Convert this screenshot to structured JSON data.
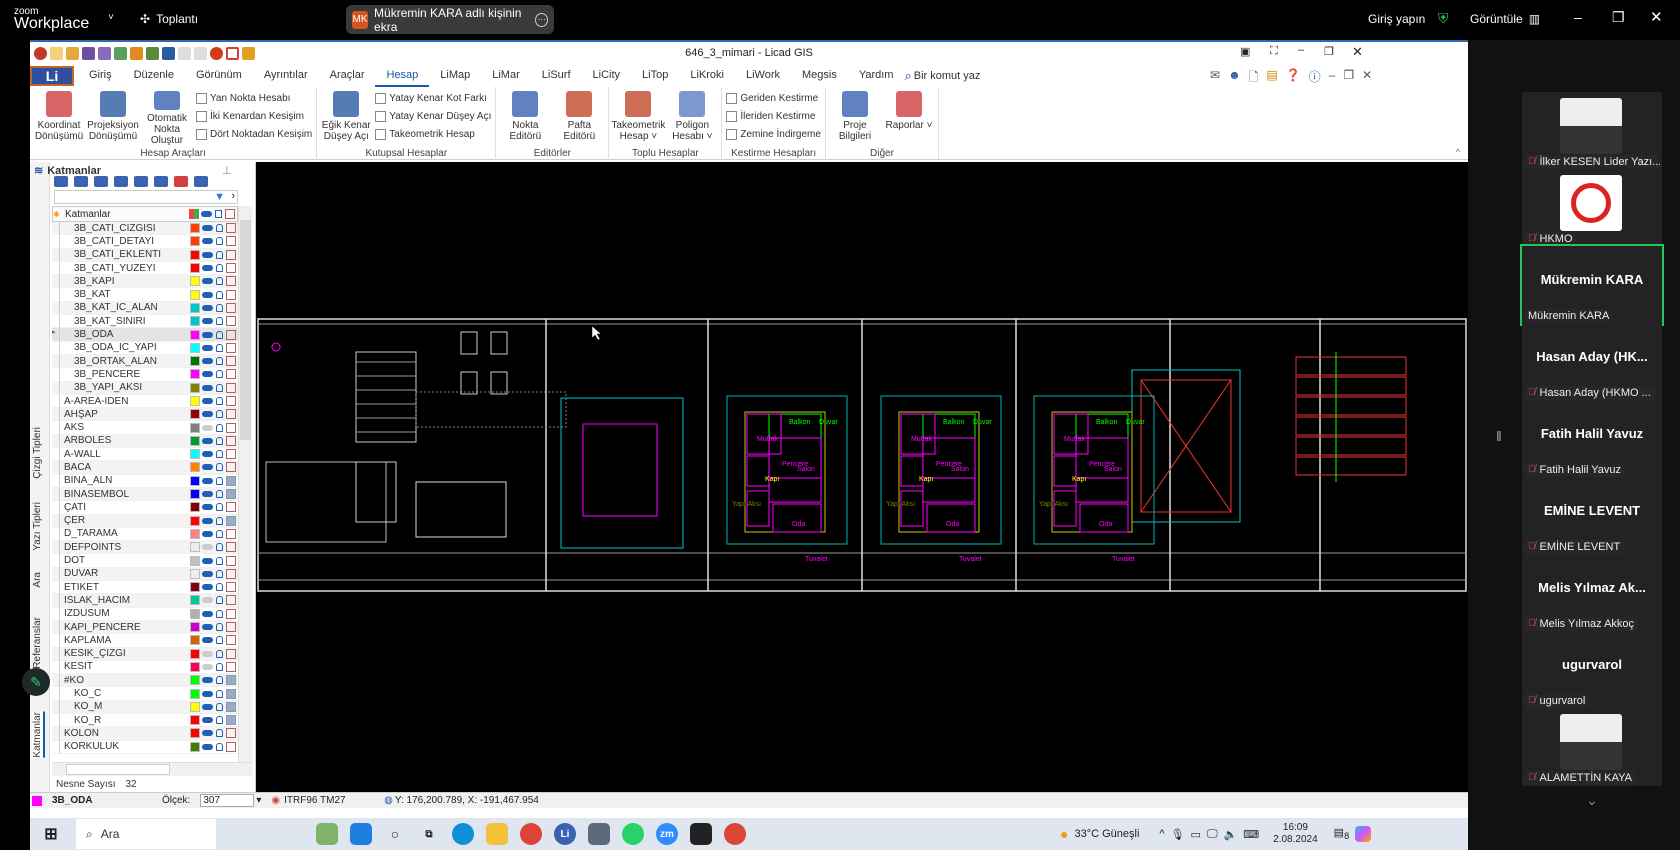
{
  "zoom": {
    "logo_small": "zoom",
    "logo_big": "Workplace",
    "meeting_label": "Toplantı",
    "share": {
      "initials": "MK",
      "text": "Mükremin KARA adlı kişinin ekra"
    },
    "sign_in": "Giriş yapın",
    "view_label": "Görüntüle",
    "accent": "#22c55e"
  },
  "app": {
    "title": "646_3_mimari  - Licad GIS",
    "li_button": "Li",
    "tabs": [
      "Giriş",
      "Düzenle",
      "Görünüm",
      "Ayrıntılar",
      "Araçlar",
      "Hesap",
      "LiMap",
      "LiMar",
      "LiSurf",
      "LiCity",
      "LiTop",
      "LiKroki",
      "LiWork",
      "Megsis",
      "Yardım"
    ],
    "active_tab": "Hesap",
    "command_search_placeholder": "Bir komut yaz"
  },
  "ribbon": {
    "groups": [
      {
        "label": "Hesap Araçları",
        "big": [
          "Koordinat Dönüşümü",
          "Projeksiyon Dönüşümü",
          "Otomatik Nokta Oluştur"
        ],
        "small": [
          "Yan Nokta Hesabı",
          "İki Kenardan Kesişim",
          "Dört Noktadan Kesişim"
        ]
      },
      {
        "label": "Kutupsal Hesaplar",
        "big": [
          "Eğik Kenar Düşey Açı"
        ],
        "small": [
          "Yatay Kenar Kot Farkı",
          "Yatay Kenar Düşey Açı",
          "Takeometrik Hesap"
        ]
      },
      {
        "label": "Editörler",
        "big": [
          "Nokta Editörü",
          "Pafta Editörü"
        ],
        "small": []
      },
      {
        "label": "Toplu Hesaplar",
        "big": [
          "Takeometrik Hesap ˅",
          "Poligon Hesabı ˅"
        ],
        "small": []
      },
      {
        "label": "Kestirme Hesapları",
        "big": [],
        "small": [
          "Geriden Kestirme",
          "İleriden Kestirme",
          "Zemine İndirgeme"
        ]
      },
      {
        "label": "Diğer",
        "big": [
          "Proje Bilgileri",
          "Raporlar ˅"
        ],
        "small": []
      }
    ]
  },
  "layers": {
    "title": "Katmanlar",
    "column_header": "Katmanlar",
    "side_tabs": [
      "Çizgi Tipleri",
      "Yazı Tipleri",
      "Ara",
      "Referanslar",
      "Katmanlar"
    ],
    "object_count_label": "Nesne Sayısı",
    "object_count": "32",
    "rows": [
      {
        "name": "3B_CATI_CIZGISI",
        "color": "#ff4000",
        "indent": true,
        "visible": true,
        "fill": false
      },
      {
        "name": "3B_CATI_DETAYI",
        "color": "#ff4000",
        "indent": true,
        "visible": true,
        "fill": false
      },
      {
        "name": "3B_CATI_EKLENTI",
        "color": "#ff0000",
        "indent": true,
        "visible": true,
        "fill": false
      },
      {
        "name": "3B_CATI_YUZEYI",
        "color": "#ff0000",
        "indent": true,
        "visible": true,
        "fill": false
      },
      {
        "name": "3B_KAPI",
        "color": "#ffff00",
        "indent": true,
        "visible": true,
        "fill": false
      },
      {
        "name": "3B_KAT",
        "color": "#ffff00",
        "indent": true,
        "visible": true,
        "fill": false
      },
      {
        "name": "3B_KAT_IC_ALAN",
        "color": "#00c8c8",
        "indent": true,
        "visible": true,
        "fill": false
      },
      {
        "name": "3B_KAT_SINIRI",
        "color": "#00c8c8",
        "indent": true,
        "visible": true,
        "fill": false
      },
      {
        "name": "3B_ODA",
        "color": "#ff00ff",
        "indent": true,
        "visible": true,
        "fill": false,
        "selected": true
      },
      {
        "name": "3B_ODA_IC_YAPI",
        "color": "#00ffff",
        "indent": true,
        "visible": true,
        "fill": false
      },
      {
        "name": "3B_ORTAK_ALAN",
        "color": "#007000",
        "indent": true,
        "visible": true,
        "fill": false
      },
      {
        "name": "3B_PENCERE",
        "color": "#ff00ff",
        "indent": true,
        "visible": true,
        "fill": false
      },
      {
        "name": "3B_YAPI_AKSI",
        "color": "#808000",
        "indent": true,
        "visible": true,
        "fill": false
      },
      {
        "name": "A-AREA-IDEN",
        "color": "#ffff00",
        "visible": true,
        "fill": false
      },
      {
        "name": "AHŞAP",
        "color": "#990000",
        "visible": true,
        "fill": false
      },
      {
        "name": "AKS",
        "color": "#808080",
        "visible": false,
        "fill": false
      },
      {
        "name": "ARBOLES",
        "color": "#009933",
        "visible": true,
        "fill": false
      },
      {
        "name": "A-WALL",
        "color": "#00ffff",
        "visible": true,
        "fill": false
      },
      {
        "name": "BACA",
        "color": "#ff8000",
        "visible": true,
        "fill": false
      },
      {
        "name": "BINA_ALN",
        "color": "#0000ff",
        "visible": true,
        "fill": true
      },
      {
        "name": "BINASEMBOL",
        "color": "#0000ff",
        "visible": true,
        "fill": true
      },
      {
        "name": "ÇATI",
        "color": "#800000",
        "visible": true,
        "fill": false
      },
      {
        "name": "ÇER",
        "color": "#ff0000",
        "visible": true,
        "fill": true
      },
      {
        "name": "D_TARAMA",
        "color": "#ff8080",
        "visible": true,
        "fill": false
      },
      {
        "name": "DEFPOINTS",
        "color": "#eeeeee",
        "visible": false,
        "fill": false
      },
      {
        "name": "DOT",
        "color": "#c0c0c0",
        "visible": true,
        "fill": false
      },
      {
        "name": "DUVAR",
        "color": "#eeeeee",
        "visible": true,
        "fill": false
      },
      {
        "name": "ETİKET",
        "color": "#800020",
        "visible": true,
        "fill": false
      },
      {
        "name": "ISLAK_HACIM",
        "color": "#00c896",
        "visible": false,
        "fill": false
      },
      {
        "name": "IZDUSUM",
        "color": "#b0b0b0",
        "visible": true,
        "fill": false
      },
      {
        "name": "KAPI_PENCERE",
        "color": "#cc00cc",
        "visible": true,
        "fill": false
      },
      {
        "name": "KAPLAMA",
        "color": "#cc6600",
        "visible": true,
        "fill": false
      },
      {
        "name": "KESİK_ÇİZGİ",
        "color": "#ff0000",
        "visible": false,
        "fill": false
      },
      {
        "name": "KESİT",
        "color": "#ff0050",
        "visible": false,
        "fill": false
      },
      {
        "name": "#KO",
        "color": "#00ff00",
        "visible": true,
        "fill": true
      },
      {
        "name": "KO_C",
        "color": "#00ff00",
        "indent": true,
        "visible": true,
        "fill": true
      },
      {
        "name": "KO_M",
        "color": "#ffff00",
        "indent": true,
        "visible": true,
        "fill": true
      },
      {
        "name": "KO_R",
        "color": "#ff0000",
        "indent": true,
        "visible": true,
        "fill": true
      },
      {
        "name": "KOLON",
        "color": "#ff0000",
        "visible": true,
        "fill": false
      },
      {
        "name": "KORKULUK",
        "color": "#408000",
        "visible": true,
        "fill": false
      }
    ]
  },
  "drawing": {
    "plan_labels": [
      {
        "t": "Mutfak",
        "c": "#ff00ff"
      },
      {
        "t": "Balkon",
        "c": "#00ff00"
      },
      {
        "t": "Duvar",
        "c": "#00ff00"
      },
      {
        "t": "Salon",
        "c": "#ff00ff"
      },
      {
        "t": "Pencere",
        "c": "#ff00ff"
      },
      {
        "t": "Kapı",
        "c": "#ffff00"
      },
      {
        "t": "Yapı Aksı",
        "c": "#808000"
      },
      {
        "t": "Oda",
        "c": "#ff00ff"
      },
      {
        "t": "Tuvalet",
        "c": "#ff00ff"
      }
    ]
  },
  "status": {
    "current_layer": "3B_ODA",
    "current_layer_color": "#ff00ff",
    "scale_label": "Ölçek:",
    "scale_value": "307",
    "crs": "ITRF96 TM27",
    "coords": "Y: 176,200.789, X: -191,467.954"
  },
  "taskbar": {
    "search": "Ara",
    "weather": "33°C  Güneşli",
    "time": "16:09",
    "date": "2.08.2024",
    "notifications": "8"
  },
  "participants": [
    {
      "label": "İlker KESEN Lider Yazı...",
      "photo": true
    },
    {
      "label": "HKMO",
      "logo": true
    },
    {
      "name": "Mükremin KARA",
      "label": "Mükremin KARA",
      "active": true,
      "nomic": true
    },
    {
      "name": "Hasan Aday (HK...",
      "label": "Hasan Aday (HKMO ..."
    },
    {
      "name": "Fatih Halil Yavuz",
      "label": "Fatih Halil Yavuz"
    },
    {
      "name": "EMİNE LEVENT",
      "label": "EMİNE LEVENT"
    },
    {
      "name": "Melis Yılmaz Ak...",
      "label": "Melis Yılmaz Akkoç"
    },
    {
      "name": "ugurvarol",
      "label": "ugurvarol"
    },
    {
      "label": "ALAMETTİN KAYA",
      "photo": true
    }
  ]
}
